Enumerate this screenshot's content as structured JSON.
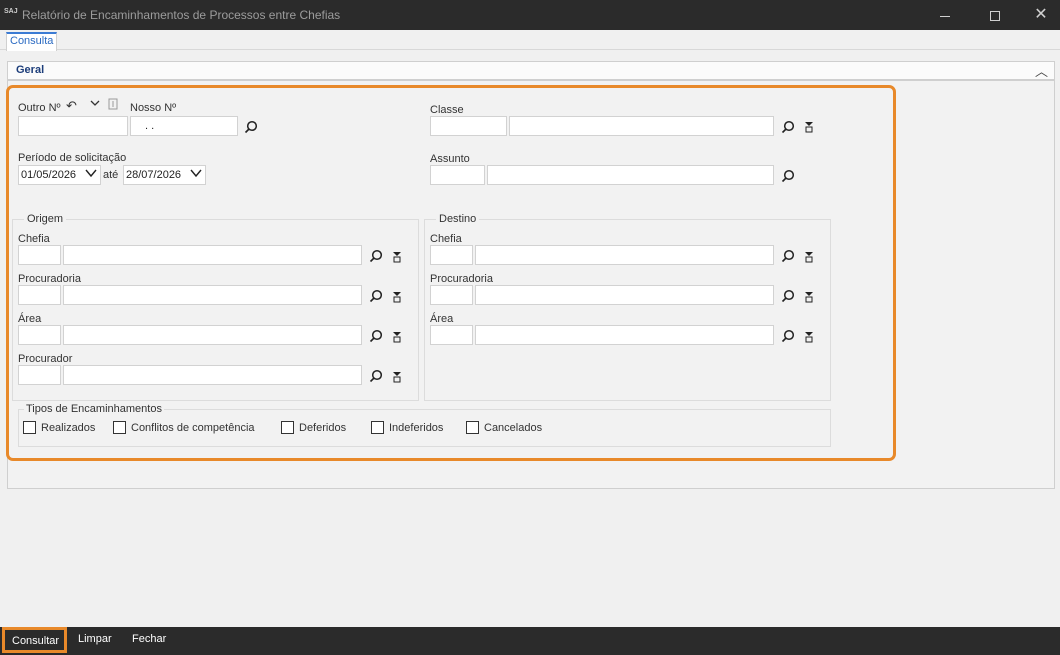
{
  "window": {
    "logo": "SAJ",
    "title": "Relatório de Encaminhamentos de Processos entre Chefias"
  },
  "tabs": [
    {
      "label": "Consulta"
    }
  ],
  "section": {
    "title": "Geral"
  },
  "form": {
    "outro_numero_label": "Outro Nº",
    "nosso_numero_label": "Nosso Nº",
    "nosso_numero_value": ". .",
    "classe_label": "Classe",
    "periodo_label": "Período de solicitação",
    "data_inicio": "01/05/2026",
    "ate_label": "até",
    "data_fim": "28/07/2026",
    "assunto_label": "Assunto"
  },
  "origem": {
    "title": "Origem",
    "chefia_label": "Chefia",
    "procuradoria_label": "Procuradoria",
    "area_label": "Área",
    "procurador_label": "Procurador"
  },
  "destino": {
    "title": "Destino",
    "chefia_label": "Chefia",
    "procuradoria_label": "Procuradoria",
    "area_label": "Área"
  },
  "tipos": {
    "title": "Tipos de Encaminhamentos",
    "options": [
      {
        "label": "Realizados",
        "checked": false
      },
      {
        "label": "Conflitos de competência",
        "checked": false
      },
      {
        "label": "Deferidos",
        "checked": false
      },
      {
        "label": "Indeferidos",
        "checked": false
      },
      {
        "label": "Cancelados",
        "checked": false
      }
    ]
  },
  "footer": {
    "consultar": "Consultar",
    "limpar": "Limpar",
    "fechar": "Fechar"
  },
  "colors": {
    "highlight": "#e8892a",
    "titlebar": "#2b2b2b",
    "tab_accent": "#3b7bd4"
  }
}
